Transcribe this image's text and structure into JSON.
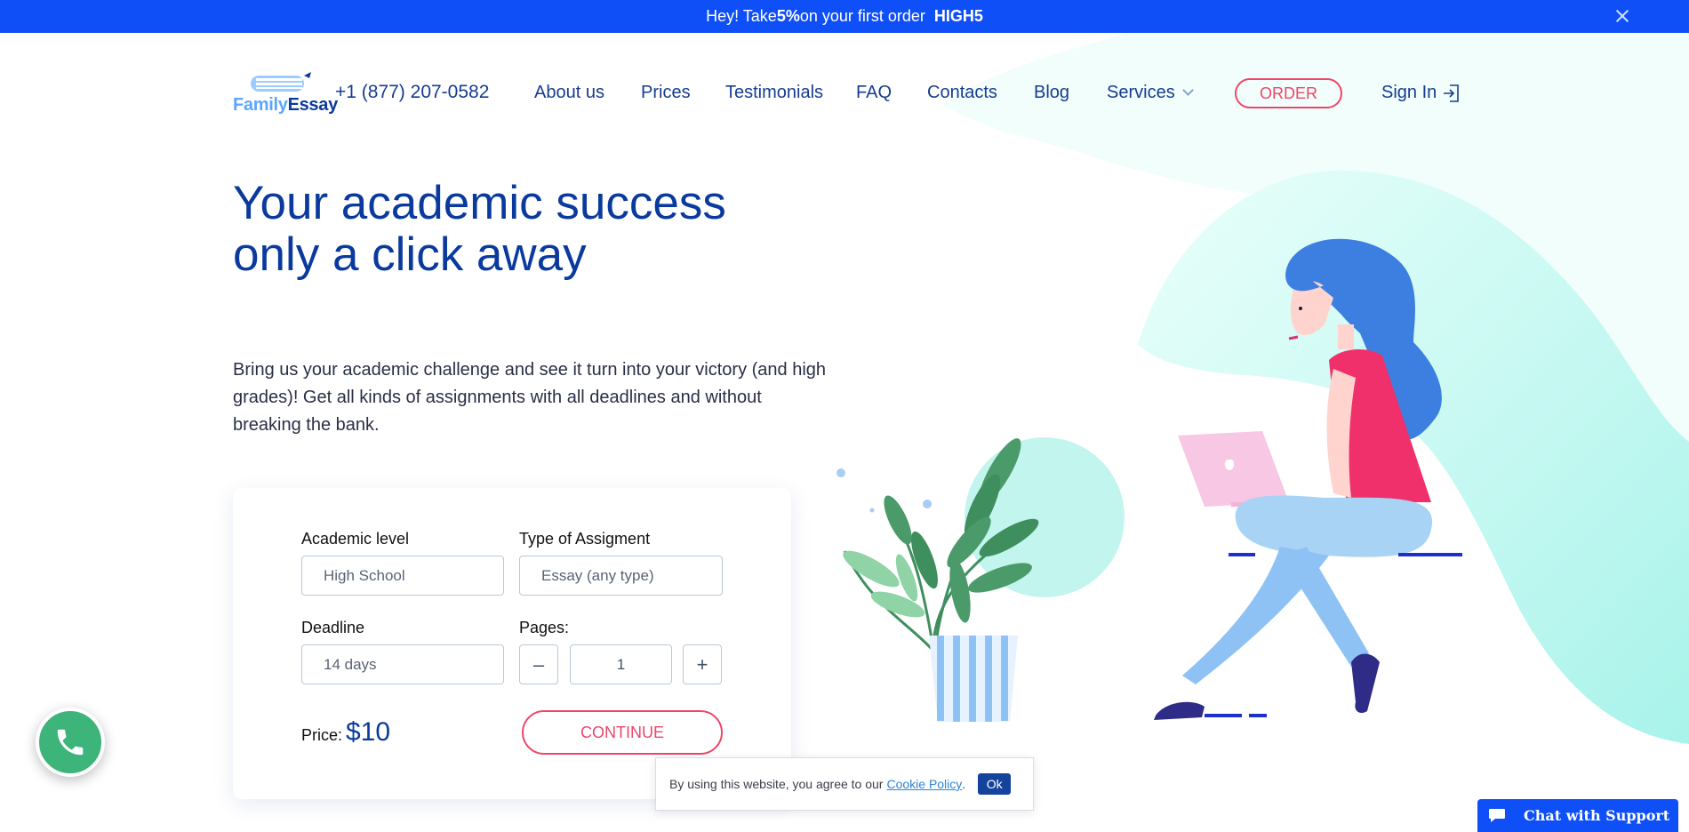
{
  "promo": {
    "prefix": "Hey! Take ",
    "discount": "5%",
    "suffix": " on your first order",
    "code": "HIGH5"
  },
  "header": {
    "logo": {
      "part1": "Family",
      "part2": "Essay"
    },
    "phone": "+1 (877) 207-0582",
    "nav": [
      "About us",
      "Prices",
      "Testimonials",
      "FAQ",
      "Contacts",
      "Blog",
      "Services"
    ],
    "order_label": "ORDER",
    "signin_label": "Sign In"
  },
  "hero": {
    "title_line1": "Your academic success",
    "title_line2": "only a click away",
    "desc_line1": "Bring us your academic challenge and see it turn into your victory (and high",
    "desc_line2": "grades)! Get all kinds of assignments with all deadlines and without",
    "desc_line3": "breaking the bank."
  },
  "calculator": {
    "academic_level_label": "Academic level",
    "academic_level_value": "High School",
    "type_label": "Type of Assigment",
    "type_value": "Essay (any type)",
    "deadline_label": "Deadline",
    "deadline_value": "14 days",
    "pages_label": "Pages:",
    "pages_value": "1",
    "minus": "–",
    "plus": "+",
    "price_label": "Price:",
    "price_value": "$10",
    "continue_label": "CONTINUE"
  },
  "cookie": {
    "text": "By using this website, you agree to our",
    "link": "Cookie Policy",
    "after": ".",
    "ok": "Ok"
  },
  "chat": {
    "label": "Chat with Support"
  },
  "colors": {
    "brand_blue": "#0f4ff7",
    "navy": "#0a3a9e",
    "accent_pink": "#ee4668",
    "mint": "#b6f5ee",
    "call_green": "#3cb47a"
  }
}
